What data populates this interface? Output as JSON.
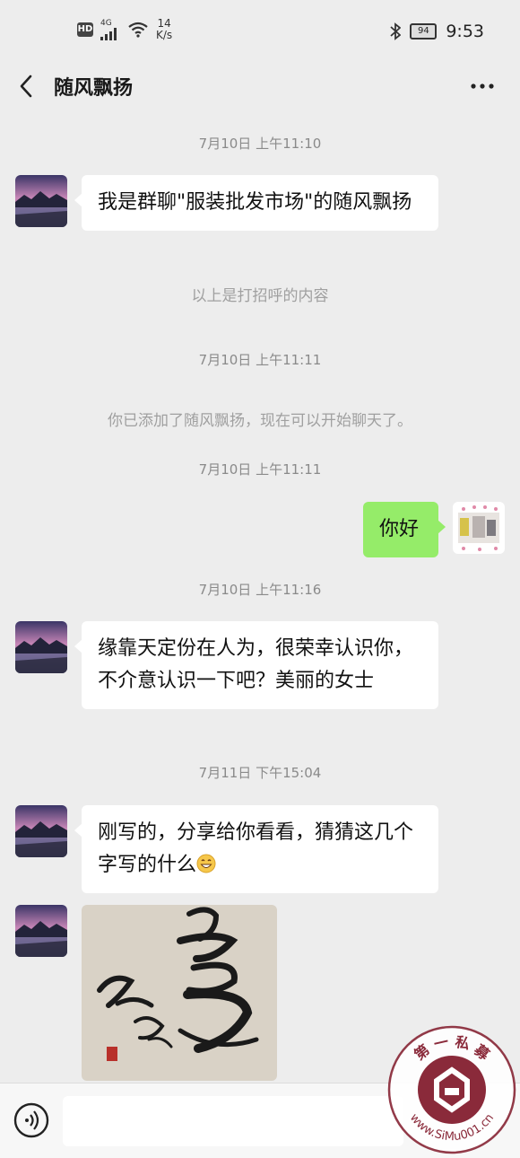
{
  "status_bar": {
    "hd": "HD",
    "network": "4G",
    "speed_value": "14",
    "speed_unit": "K/s",
    "battery": "94",
    "time": "9:53"
  },
  "header": {
    "title": "随风飘扬"
  },
  "messages": {
    "ts1": "7月10日 上午11:10",
    "msg1": "我是群聊\"服装批发市场\"的随风飘扬",
    "sys1": "以上是打招呼的内容",
    "ts2": "7月10日 上午11:11",
    "sys2": "你已添加了随风飘扬，现在可以开始聊天了。",
    "ts3": "7月10日 上午11:11",
    "msg2": "你好",
    "ts4": "7月10日 上午11:16",
    "msg3": "缘靠天定份在人为，很荣幸认识你，不介意认识一下吧？美丽的女士",
    "ts5": "7月11日 下午15:04",
    "msg4": "刚写的，分享给你看看，猜猜这几个字写的什么"
  },
  "watermark": {
    "ring_text": "第 一 私 募",
    "url_text": "www.SiMu001.cn"
  },
  "colors": {
    "background": "#ededed",
    "self_bubble": "#95ec69",
    "other_bubble": "#ffffff"
  }
}
